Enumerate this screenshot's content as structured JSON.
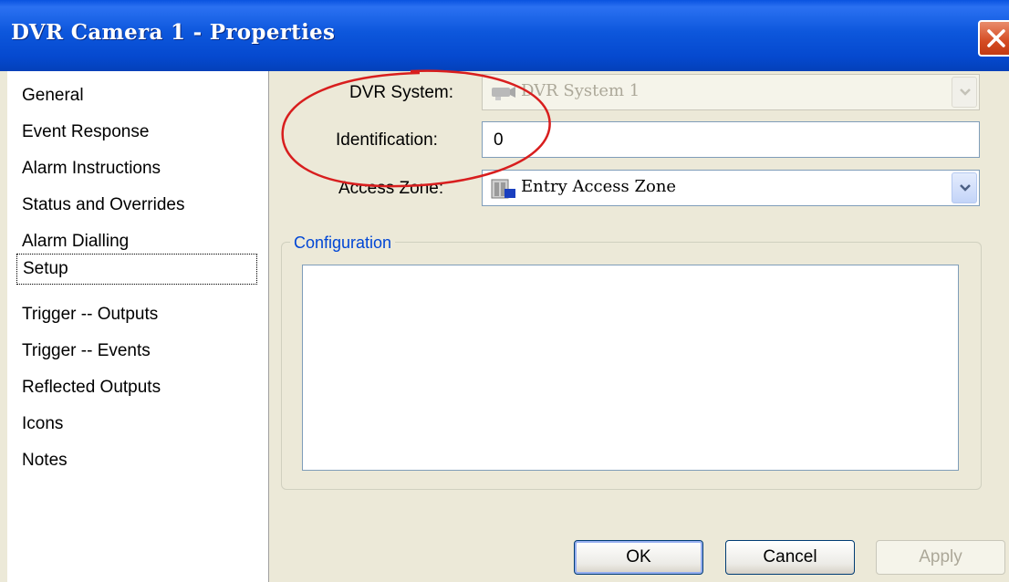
{
  "window": {
    "title": "DVR Camera 1 - Properties"
  },
  "nav": {
    "items": [
      {
        "label": "General"
      },
      {
        "label": "Event Response"
      },
      {
        "label": "Alarm Instructions"
      },
      {
        "label": "Status and Overrides"
      },
      {
        "label": "Alarm Dialling"
      },
      {
        "label": "Setup"
      },
      {
        "label": "Trigger -- Outputs"
      },
      {
        "label": "Trigger -- Events"
      },
      {
        "label": "Reflected Outputs"
      },
      {
        "label": "Icons"
      },
      {
        "label": "Notes"
      }
    ],
    "selected": "Setup"
  },
  "form": {
    "dvr_system_label": "DVR System:",
    "dvr_system_value": "DVR System 1",
    "identification_label": "Identification:",
    "identification_value": "0",
    "access_zone_label": "Access Zone:",
    "access_zone_value": "Entry Access Zone"
  },
  "configuration": {
    "title": "Configuration"
  },
  "buttons": {
    "ok": "OK",
    "cancel": "Cancel",
    "apply": "Apply"
  },
  "colors": {
    "titlebar": "#0a53e0",
    "close": "#d44b22",
    "annotation": "#d81e1e",
    "group_title": "#0046d5"
  },
  "icons": {
    "dvr_system": "camera-icon",
    "access_zone": "door-icon",
    "dropdown": "chevron-down-icon",
    "close": "close-icon"
  }
}
